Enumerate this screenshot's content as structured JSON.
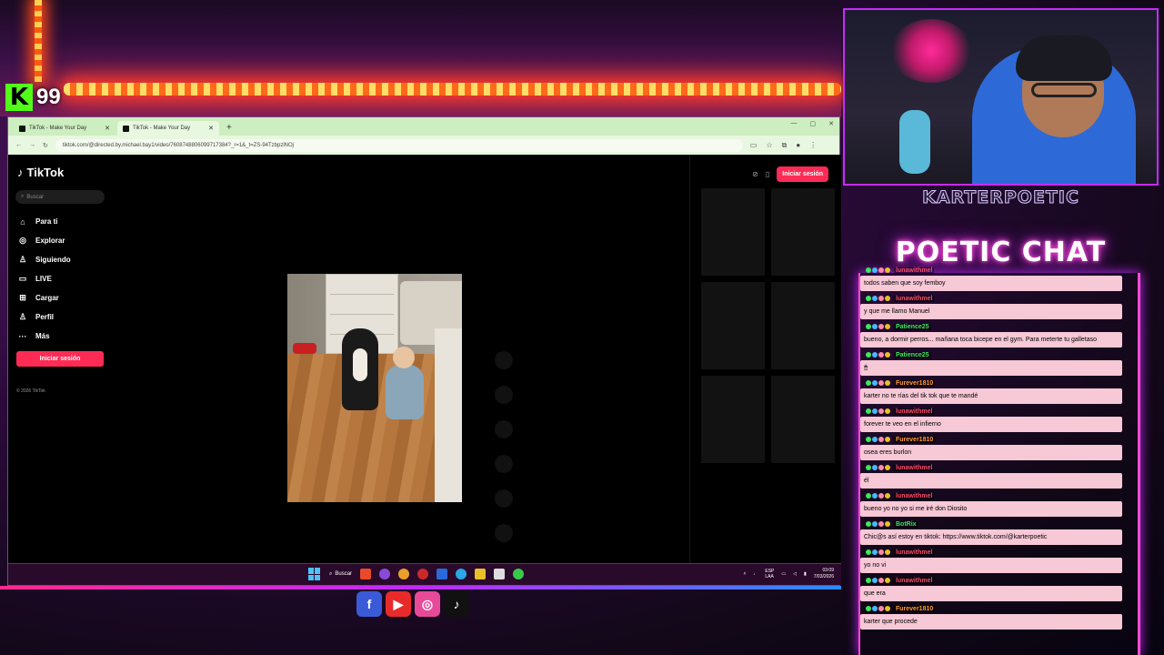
{
  "overlay": {
    "kick_logo": "K",
    "kick_viewers": "99",
    "streamer_name": "KARTERPOETIC",
    "chat_title": "POETIC CHAT"
  },
  "browser": {
    "tabs": [
      {
        "label": "TikTok - Make Your Day",
        "active": false
      },
      {
        "label": "TikTok - Make Your Day",
        "active": true
      }
    ],
    "new_tab": "+",
    "url": "tiktok.com/@directed.by.michael.bay1/video/7608748806099717384?_r=1&_t=ZS-94TzbpzlNOj"
  },
  "tiktok": {
    "brand": "TikTok",
    "search_placeholder": "Buscar",
    "nav": [
      {
        "icon": "home-icon",
        "glyph": "⌂",
        "label": "Para ti"
      },
      {
        "icon": "compass-icon",
        "glyph": "◎",
        "label": "Explorar"
      },
      {
        "icon": "following-icon",
        "glyph": "♙",
        "label": "Siguiendo"
      },
      {
        "icon": "live-icon",
        "glyph": "▭",
        "label": "LIVE"
      },
      {
        "icon": "upload-icon",
        "glyph": "⊞",
        "label": "Cargar"
      },
      {
        "icon": "profile-icon",
        "glyph": "♙",
        "label": "Perfil"
      },
      {
        "icon": "more-icon",
        "glyph": "···",
        "label": "Más"
      }
    ],
    "login_side": "Iniciar sesión",
    "login_top": "Iniciar sesión",
    "copyright": "© 2026 TikTok"
  },
  "taskbar": {
    "search": "Buscar",
    "lang": "ESP\nLAA",
    "time": "03:09",
    "date": "7/03/2026"
  },
  "chat": [
    {
      "user": "lunawithmel",
      "user_color": "#ff4a6a",
      "text": "todos saben que soy femboy"
    },
    {
      "user": "lunawithmel",
      "user_color": "#ff4a6a",
      "text": "y que me llamo Manuel"
    },
    {
      "user": "Patience25",
      "user_color": "#3ae85a",
      "text": "bueno, a dormir perros... mañana toca bicepe en el gym. Para meterte tu galletaso"
    },
    {
      "user": "Patience25",
      "user_color": "#3ae85a",
      "text": "🖱"
    },
    {
      "user": "Furever1810",
      "user_color": "#ff9a2a",
      "text": "karter no te rías del tik tok que te mandé"
    },
    {
      "user": "lunawithmel",
      "user_color": "#ff4a6a",
      "text": "forever te veo en el infierno"
    },
    {
      "user": "Furever1810",
      "user_color": "#ff9a2a",
      "text": "osea eres burlon"
    },
    {
      "user": "lunawithmel",
      "user_color": "#ff4a6a",
      "text": "él"
    },
    {
      "user": "lunawithmel",
      "user_color": "#ff4a6a",
      "text": "bueno yo no yo si me iré don Diosito"
    },
    {
      "user": "BotRix",
      "user_color": "#3ae85a",
      "text": "Chic@s así estoy en tiktok: https://www.tiktok.com/@karterpoetic"
    },
    {
      "user": "lunawithmel",
      "user_color": "#ff4a6a",
      "text": "yo no vi"
    },
    {
      "user": "lunawithmel",
      "user_color": "#ff4a6a",
      "text": "que era"
    },
    {
      "user": "Furever1810",
      "user_color": "#ff9a2a",
      "text": "karter que procede"
    }
  ],
  "socials": [
    {
      "name": "facebook-icon",
      "glyph": "f",
      "color": "#3a5ad8"
    },
    {
      "name": "youtube-icon",
      "glyph": "▶",
      "color": "#e82a2a"
    },
    {
      "name": "instagram-icon",
      "glyph": "◎",
      "color": "#e84a9a"
    },
    {
      "name": "tiktok-icon",
      "glyph": "♪",
      "color": "#111111"
    }
  ]
}
